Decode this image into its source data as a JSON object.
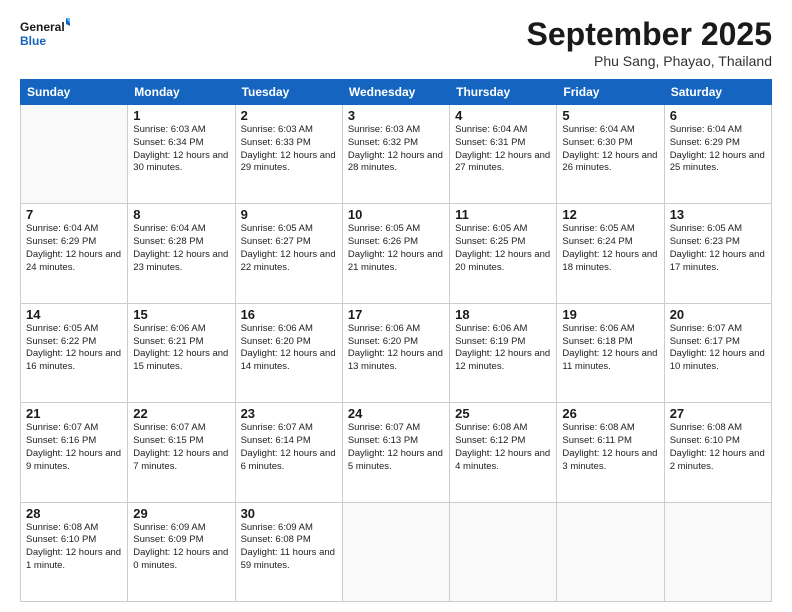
{
  "header": {
    "logo_general": "General",
    "logo_blue": "Blue",
    "title": "September 2025",
    "location": "Phu Sang, Phayao, Thailand"
  },
  "days_of_week": [
    "Sunday",
    "Monday",
    "Tuesday",
    "Wednesday",
    "Thursday",
    "Friday",
    "Saturday"
  ],
  "weeks": [
    [
      {
        "day": "",
        "sunrise": "",
        "sunset": "",
        "daylight": ""
      },
      {
        "day": "1",
        "sunrise": "Sunrise: 6:03 AM",
        "sunset": "Sunset: 6:34 PM",
        "daylight": "Daylight: 12 hours and 30 minutes."
      },
      {
        "day": "2",
        "sunrise": "Sunrise: 6:03 AM",
        "sunset": "Sunset: 6:33 PM",
        "daylight": "Daylight: 12 hours and 29 minutes."
      },
      {
        "day": "3",
        "sunrise": "Sunrise: 6:03 AM",
        "sunset": "Sunset: 6:32 PM",
        "daylight": "Daylight: 12 hours and 28 minutes."
      },
      {
        "day": "4",
        "sunrise": "Sunrise: 6:04 AM",
        "sunset": "Sunset: 6:31 PM",
        "daylight": "Daylight: 12 hours and 27 minutes."
      },
      {
        "day": "5",
        "sunrise": "Sunrise: 6:04 AM",
        "sunset": "Sunset: 6:30 PM",
        "daylight": "Daylight: 12 hours and 26 minutes."
      },
      {
        "day": "6",
        "sunrise": "Sunrise: 6:04 AM",
        "sunset": "Sunset: 6:29 PM",
        "daylight": "Daylight: 12 hours and 25 minutes."
      }
    ],
    [
      {
        "day": "7",
        "sunrise": "Sunrise: 6:04 AM",
        "sunset": "Sunset: 6:29 PM",
        "daylight": "Daylight: 12 hours and 24 minutes."
      },
      {
        "day": "8",
        "sunrise": "Sunrise: 6:04 AM",
        "sunset": "Sunset: 6:28 PM",
        "daylight": "Daylight: 12 hours and 23 minutes."
      },
      {
        "day": "9",
        "sunrise": "Sunrise: 6:05 AM",
        "sunset": "Sunset: 6:27 PM",
        "daylight": "Daylight: 12 hours and 22 minutes."
      },
      {
        "day": "10",
        "sunrise": "Sunrise: 6:05 AM",
        "sunset": "Sunset: 6:26 PM",
        "daylight": "Daylight: 12 hours and 21 minutes."
      },
      {
        "day": "11",
        "sunrise": "Sunrise: 6:05 AM",
        "sunset": "Sunset: 6:25 PM",
        "daylight": "Daylight: 12 hours and 20 minutes."
      },
      {
        "day": "12",
        "sunrise": "Sunrise: 6:05 AM",
        "sunset": "Sunset: 6:24 PM",
        "daylight": "Daylight: 12 hours and 18 minutes."
      },
      {
        "day": "13",
        "sunrise": "Sunrise: 6:05 AM",
        "sunset": "Sunset: 6:23 PM",
        "daylight": "Daylight: 12 hours and 17 minutes."
      }
    ],
    [
      {
        "day": "14",
        "sunrise": "Sunrise: 6:05 AM",
        "sunset": "Sunset: 6:22 PM",
        "daylight": "Daylight: 12 hours and 16 minutes."
      },
      {
        "day": "15",
        "sunrise": "Sunrise: 6:06 AM",
        "sunset": "Sunset: 6:21 PM",
        "daylight": "Daylight: 12 hours and 15 minutes."
      },
      {
        "day": "16",
        "sunrise": "Sunrise: 6:06 AM",
        "sunset": "Sunset: 6:20 PM",
        "daylight": "Daylight: 12 hours and 14 minutes."
      },
      {
        "day": "17",
        "sunrise": "Sunrise: 6:06 AM",
        "sunset": "Sunset: 6:20 PM",
        "daylight": "Daylight: 12 hours and 13 minutes."
      },
      {
        "day": "18",
        "sunrise": "Sunrise: 6:06 AM",
        "sunset": "Sunset: 6:19 PM",
        "daylight": "Daylight: 12 hours and 12 minutes."
      },
      {
        "day": "19",
        "sunrise": "Sunrise: 6:06 AM",
        "sunset": "Sunset: 6:18 PM",
        "daylight": "Daylight: 12 hours and 11 minutes."
      },
      {
        "day": "20",
        "sunrise": "Sunrise: 6:07 AM",
        "sunset": "Sunset: 6:17 PM",
        "daylight": "Daylight: 12 hours and 10 minutes."
      }
    ],
    [
      {
        "day": "21",
        "sunrise": "Sunrise: 6:07 AM",
        "sunset": "Sunset: 6:16 PM",
        "daylight": "Daylight: 12 hours and 9 minutes."
      },
      {
        "day": "22",
        "sunrise": "Sunrise: 6:07 AM",
        "sunset": "Sunset: 6:15 PM",
        "daylight": "Daylight: 12 hours and 7 minutes."
      },
      {
        "day": "23",
        "sunrise": "Sunrise: 6:07 AM",
        "sunset": "Sunset: 6:14 PM",
        "daylight": "Daylight: 12 hours and 6 minutes."
      },
      {
        "day": "24",
        "sunrise": "Sunrise: 6:07 AM",
        "sunset": "Sunset: 6:13 PM",
        "daylight": "Daylight: 12 hours and 5 minutes."
      },
      {
        "day": "25",
        "sunrise": "Sunrise: 6:08 AM",
        "sunset": "Sunset: 6:12 PM",
        "daylight": "Daylight: 12 hours and 4 minutes."
      },
      {
        "day": "26",
        "sunrise": "Sunrise: 6:08 AM",
        "sunset": "Sunset: 6:11 PM",
        "daylight": "Daylight: 12 hours and 3 minutes."
      },
      {
        "day": "27",
        "sunrise": "Sunrise: 6:08 AM",
        "sunset": "Sunset: 6:10 PM",
        "daylight": "Daylight: 12 hours and 2 minutes."
      }
    ],
    [
      {
        "day": "28",
        "sunrise": "Sunrise: 6:08 AM",
        "sunset": "Sunset: 6:10 PM",
        "daylight": "Daylight: 12 hours and 1 minute."
      },
      {
        "day": "29",
        "sunrise": "Sunrise: 6:09 AM",
        "sunset": "Sunset: 6:09 PM",
        "daylight": "Daylight: 12 hours and 0 minutes."
      },
      {
        "day": "30",
        "sunrise": "Sunrise: 6:09 AM",
        "sunset": "Sunset: 6:08 PM",
        "daylight": "Daylight: 11 hours and 59 minutes."
      },
      {
        "day": "",
        "sunrise": "",
        "sunset": "",
        "daylight": ""
      },
      {
        "day": "",
        "sunrise": "",
        "sunset": "",
        "daylight": ""
      },
      {
        "day": "",
        "sunrise": "",
        "sunset": "",
        "daylight": ""
      },
      {
        "day": "",
        "sunrise": "",
        "sunset": "",
        "daylight": ""
      }
    ]
  ]
}
